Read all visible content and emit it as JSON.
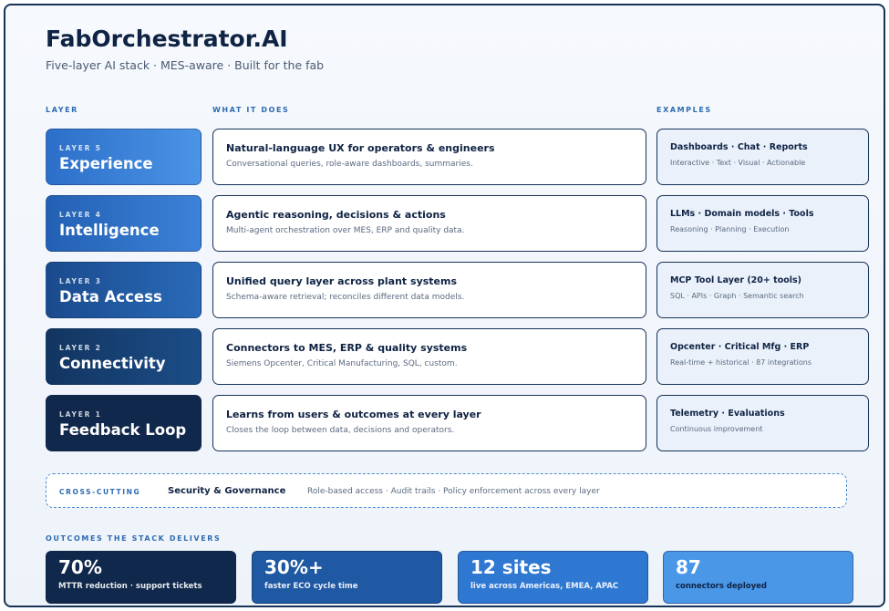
{
  "title": "FabOrchestrator.AI",
  "subtitle": "Five-layer AI stack · MES-aware · Built for the fab",
  "columns": {
    "layer": "LAYER",
    "what": "WHAT IT DOES",
    "examples": "EXAMPLES"
  },
  "layers": [
    {
      "number": "LAYER 5",
      "name": "Experience",
      "what_title": "Natural-language UX for operators & engineers",
      "what_desc": "Conversational queries, role-aware dashboards, summaries.",
      "ex_title": "Dashboards · Chat · Reports",
      "ex_desc": "Interactive · Text · Visual · Actionable"
    },
    {
      "number": "LAYER 4",
      "name": "Intelligence",
      "what_title": "Agentic reasoning, decisions & actions",
      "what_desc": "Multi-agent orchestration over MES, ERP and quality data.",
      "ex_title": "LLMs · Domain models · Tools",
      "ex_desc": "Reasoning · Planning · Execution"
    },
    {
      "number": "LAYER 3",
      "name": "Data Access",
      "what_title": "Unified query layer across plant systems",
      "what_desc": "Schema-aware retrieval; reconciles different data models.",
      "ex_title": "MCP Tool Layer (20+ tools)",
      "ex_desc": "SQL · APIs · Graph · Semantic search"
    },
    {
      "number": "LAYER 2",
      "name": "Connectivity",
      "what_title": "Connectors to MES, ERP & quality systems",
      "what_desc": "Siemens Opcenter, Critical Manufacturing, SQL, custom.",
      "ex_title": "Opcenter · Critical Mfg · ERP",
      "ex_desc": "Real-time + historical · 87 integrations"
    },
    {
      "number": "LAYER 1",
      "name": "Feedback Loop",
      "what_title": "Learns from users & outcomes at every layer",
      "what_desc": "Closes the loop between data, decisions and operators.",
      "ex_title": "Telemetry · Evaluations",
      "ex_desc": "Continuous improvement"
    }
  ],
  "cross_cutting": {
    "tag": "CROSS-CUTTING",
    "title": "Security & Governance",
    "desc": "Role-based access · Audit trails · Policy enforcement across every layer"
  },
  "outcomes_heading": "OUTCOMES THE STACK DELIVERS",
  "outcomes": [
    {
      "value": "70%",
      "label": "MTTR reduction · support tickets"
    },
    {
      "value": "30%+",
      "label": "faster ECO cycle time"
    },
    {
      "value": "12 sites",
      "label": "live across Americas, EMEA, APAC"
    },
    {
      "value": "87",
      "label": "connectors deployed"
    }
  ]
}
